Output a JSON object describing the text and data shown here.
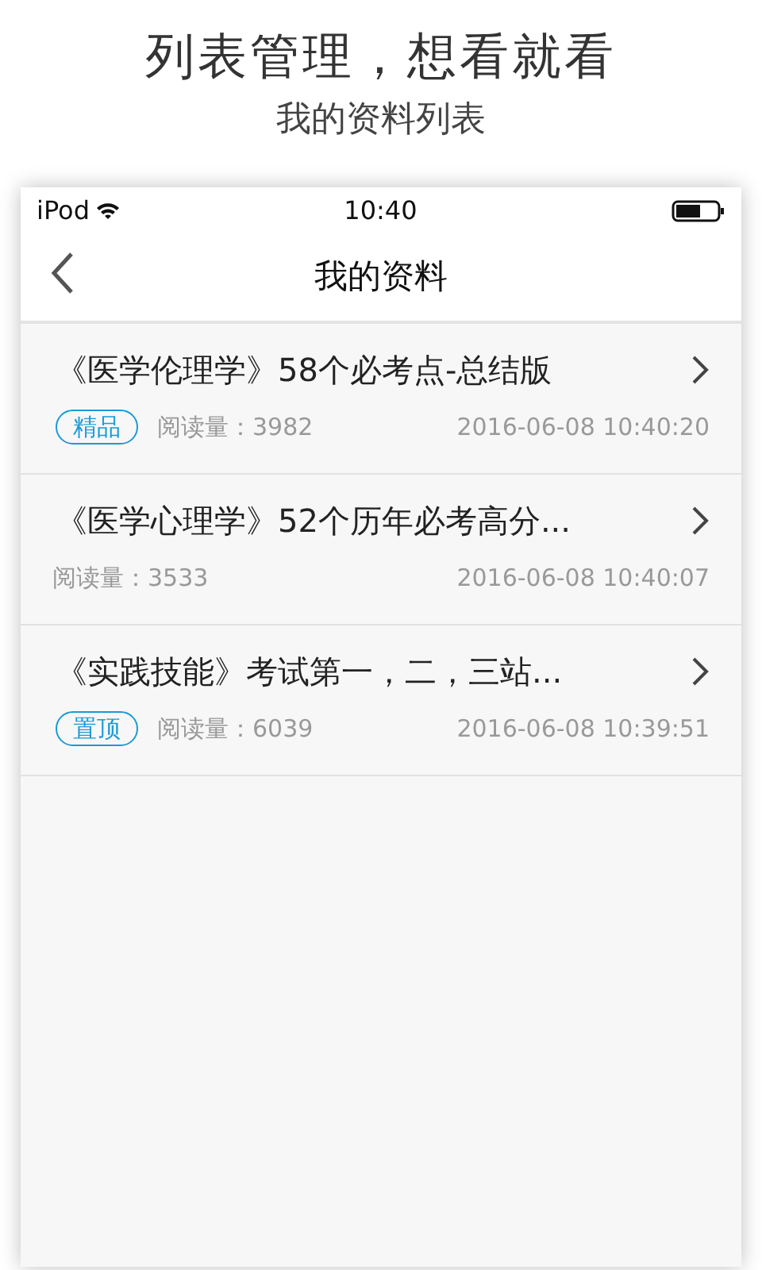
{
  "header": {
    "title": "列表管理，想看就看",
    "subtitle": "我的资料列表"
  },
  "status_bar": {
    "carrier": "iPod",
    "time": "10:40"
  },
  "nav": {
    "title": "我的资料"
  },
  "items": [
    {
      "title": "《医学伦理学》58个必考点-总结版",
      "tag": "精品",
      "reads": "阅读量：3982",
      "date": "2016-06-08 10:40:20"
    },
    {
      "title": "《医学心理学》52个历年必考高分...",
      "reads": "阅读量：3533",
      "date": "2016-06-08 10:40:07"
    },
    {
      "title": "《实践技能》考试第一，二，三站...",
      "tag": "置顶",
      "reads": "阅读量：6039",
      "date": "2016-06-08 10:39:51"
    }
  ]
}
